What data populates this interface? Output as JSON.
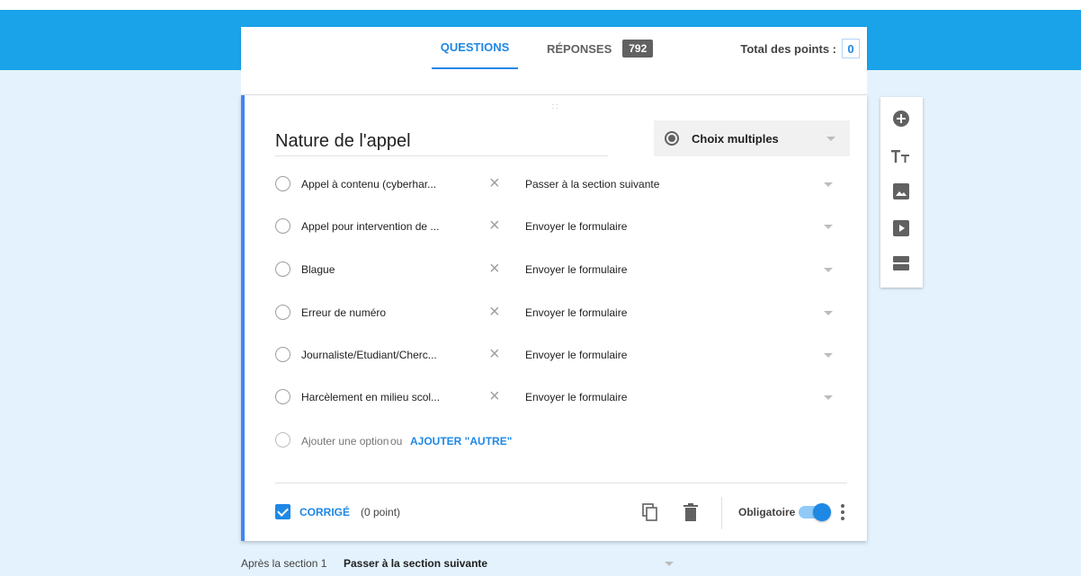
{
  "header": {
    "tabs": [
      {
        "label": "QUESTIONS",
        "active": true
      },
      {
        "label": "RÉPONSES",
        "badge": "792"
      }
    ],
    "points_label": "Total des points :",
    "points_value": "0"
  },
  "question": {
    "drag_handle": "∷",
    "title": "Nature de l'appel",
    "type_label": "Choix multiples",
    "options": [
      {
        "label": "Appel à contenu (cyberhar...",
        "goto": "Passer à la section suivante"
      },
      {
        "label": "Appel pour intervention de ...",
        "goto": "Envoyer le formulaire"
      },
      {
        "label": "Blague",
        "goto": "Envoyer le formulaire"
      },
      {
        "label": "Erreur de numéro",
        "goto": "Envoyer le formulaire"
      },
      {
        "label": "Journaliste/Etudiant/Cherc...",
        "goto": "Envoyer le formulaire"
      },
      {
        "label": "Harcèlement en milieu scol...",
        "goto": "Envoyer le formulaire"
      }
    ],
    "add_option": "Ajouter une option",
    "add_or": "ou",
    "add_other": "AJOUTER \"AUTRE\"",
    "option_remove_glyph": "×",
    "corrige_label": "CORRIGÉ",
    "corrige_points": "(0 point)",
    "required_label": "Obligatoire",
    "required_on": true
  },
  "toolbar": {
    "icons": [
      "add-question-icon",
      "title-text-icon",
      "image-icon",
      "video-icon",
      "section-icon"
    ]
  },
  "after_section": {
    "label": "Après la section 1",
    "goto": "Passer à la section suivante"
  },
  "colors": {
    "brand_blue": "#1aa3e9",
    "accent": "#1e88e5",
    "background": "#e3f2fd",
    "card_border": "#4285f4"
  }
}
